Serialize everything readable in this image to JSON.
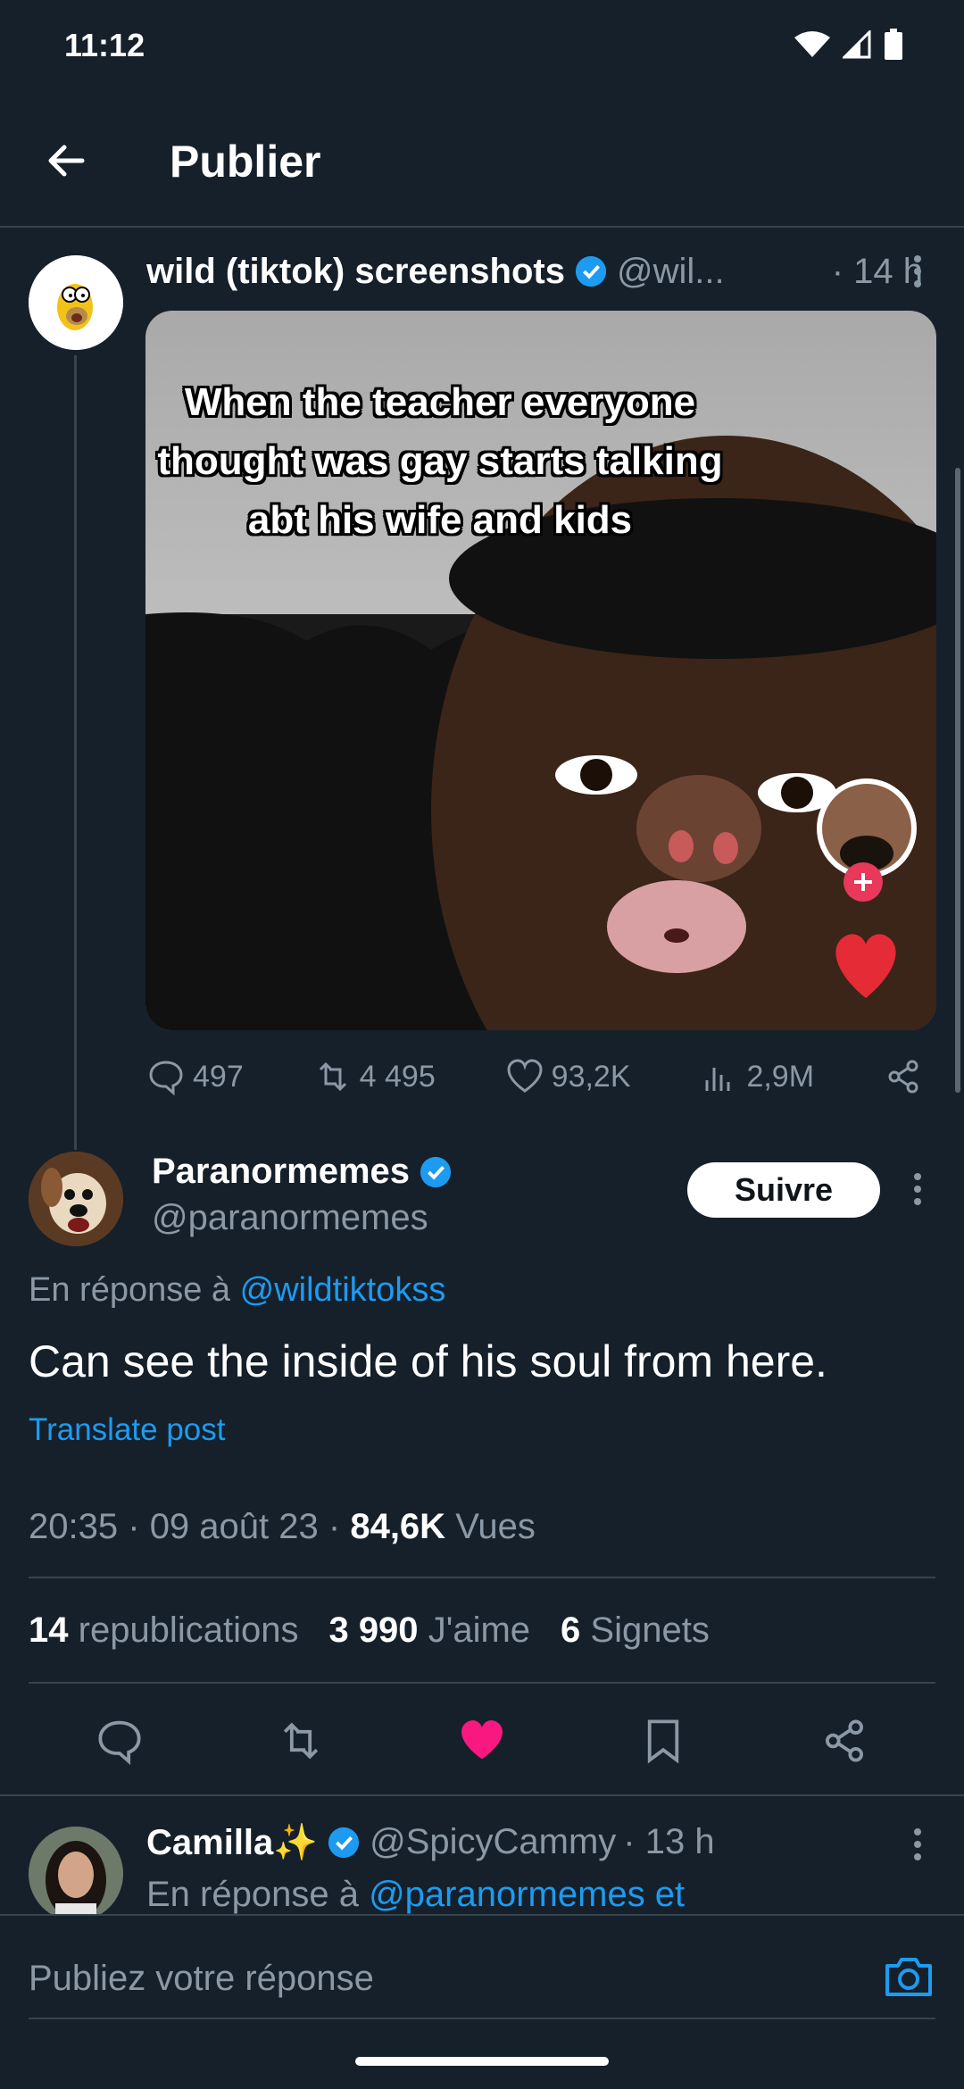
{
  "status_bar": {
    "time": "11:12"
  },
  "header": {
    "title": "Publier"
  },
  "parent_post": {
    "author_name": "wild (tiktok) screenshots",
    "handle": "@wil...",
    "time": "· 14 h",
    "media_caption": "When the teacher everyone thought was gay starts talking abt his wife and kids",
    "actions": {
      "replies": "497",
      "reposts": "4 495",
      "likes": "93,2K",
      "views": "2,9M"
    }
  },
  "main_post": {
    "author_name": "Paranormemes",
    "handle": "@paranormemes",
    "follow_label": "Suivre",
    "reply_prefix": "En réponse à",
    "reply_to": "@wildtiktokss",
    "text": "Can see the inside of his soul from here.",
    "translate_label": "Translate post",
    "time": "20:35",
    "date": "09 août 23",
    "views_count": "84,6K",
    "views_label": "Vues",
    "stats": {
      "reposts_count": "14",
      "reposts_label": "republications",
      "likes_count": "3 990",
      "likes_label": "J'aime",
      "bookmarks_count": "6",
      "bookmarks_label": "Signets"
    },
    "liked": true,
    "like_color": "#f91880"
  },
  "reply_post": {
    "author_name": "Camilla✨",
    "handle": "@SpicyCammy",
    "time": "· 13 h",
    "reply_prefix": "En réponse à",
    "reply_to": "@paranormemes et"
  },
  "compose": {
    "placeholder": "Publiez votre réponse"
  },
  "colors": {
    "background": "#15202b",
    "accent": "#1d9bf0",
    "muted": "#8b98a5",
    "verified": "#1d9bf0"
  }
}
